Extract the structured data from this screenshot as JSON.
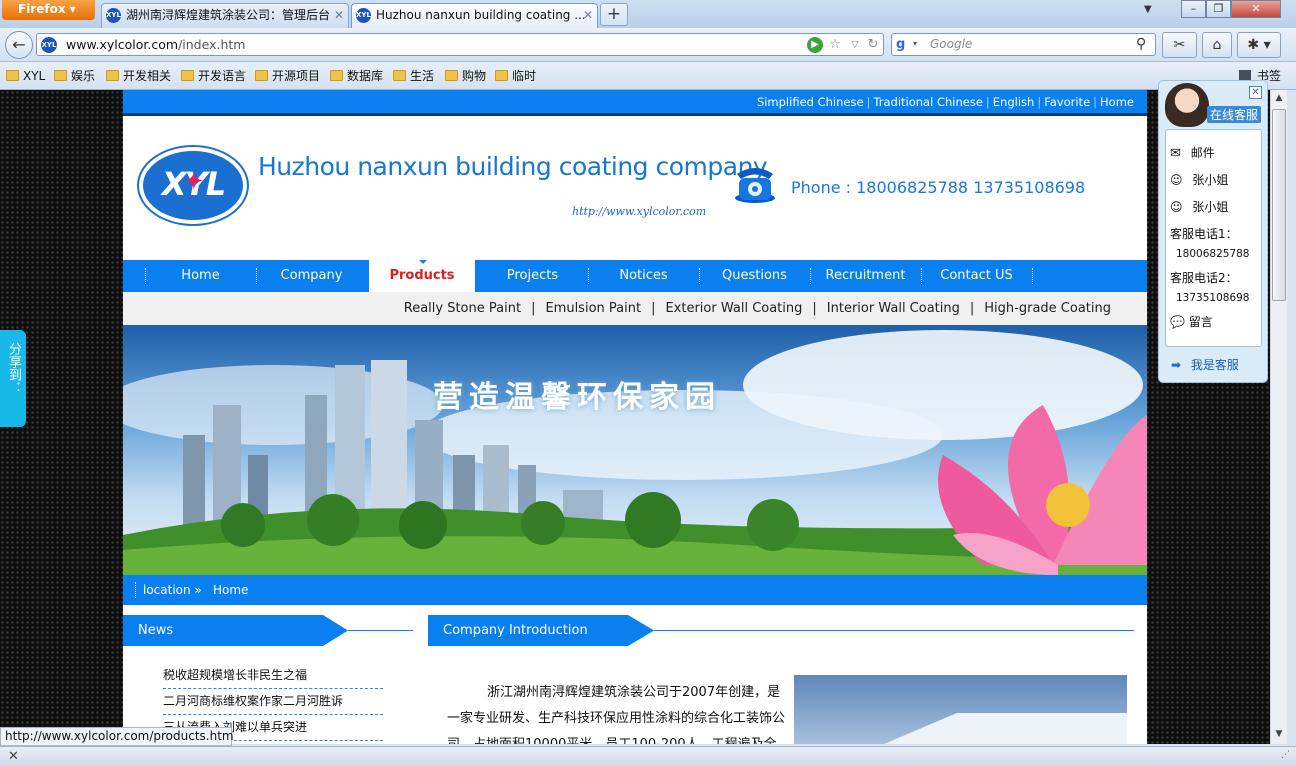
{
  "browser": {
    "app_button": "Firefox",
    "tabs": [
      {
        "title": "湖州南浔辉煌建筑涂装公司：管理后台"
      },
      {
        "title": "Huzhou nanxun building coating ..."
      }
    ],
    "url_host": "www.xylcolor.com",
    "url_path": "/index.htm",
    "search_placeholder": "Google",
    "bookmarks": [
      "XYL",
      "娱乐",
      "开发相关",
      "开发语言",
      "开源项目",
      "数据库",
      "生活",
      "购物",
      "临时"
    ],
    "bookmarks_menu": "书签",
    "status_url": "http://www.xylcolor.com/products.htm"
  },
  "site": {
    "top_links": [
      "Simplified Chinese",
      "Traditional Chinese",
      "English",
      "Favorite",
      "Home"
    ],
    "logo_text": "XYL",
    "title": "Huzhou nanxun building coating company",
    "url": "http://www.xylcolor.com",
    "phone": "Phone : 18006825788 13735108698",
    "nav": [
      "Home",
      "Company",
      "Products",
      "Projects",
      "Notices",
      "Questions",
      "Recruitment",
      "Contact US"
    ],
    "subnav": [
      "Really Stone Paint",
      "Emulsion Paint",
      "Exterior Wall Coating",
      "Interior Wall Coating",
      "High-grade Coating"
    ],
    "banner_slogan": "营造温馨环保家园",
    "location_label": "location »",
    "location_current": "Home",
    "news_title": "News",
    "news": [
      "税收超规模增长非民生之福",
      "二月河商标维权案作家二月河胜诉",
      "三从流费入刘难以单兵突进"
    ],
    "intro_title": "Company Introduction",
    "intro_text": "浙江湖州南浔辉煌建筑涂装公司于2007年创建，是一家专业研发、生产科技环保应用性涂料的综合化工装饰公司，占地面积10000平米，员工100-200人，工程遍及全"
  },
  "share_tab": "分享到：",
  "service_panel": {
    "header": "在线客服",
    "rows": [
      "邮件",
      "张小姐",
      "张小姐"
    ],
    "hotline1_label": "客服电话1：",
    "hotline1": "18006825788",
    "hotline2_label": "客服电话2：",
    "hotline2": "13735108698",
    "message": "留言",
    "footer": "我是客服"
  }
}
